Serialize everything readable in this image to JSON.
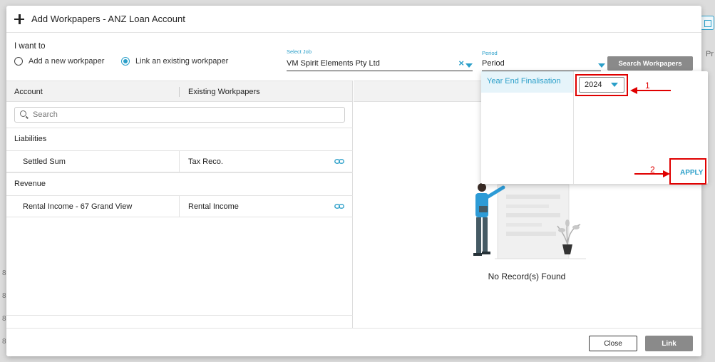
{
  "modal": {
    "title": "Add Workpapers - ANZ Loan Account"
  },
  "i_want_to": {
    "label": "I want to",
    "options": [
      {
        "label": "Add a new workpaper",
        "selected": false
      },
      {
        "label": "Link an existing workpaper",
        "selected": true
      }
    ]
  },
  "job": {
    "label": "Select Job",
    "value": "VM Spirit Elements Pty Ltd",
    "clear": "×"
  },
  "period": {
    "label": "Period",
    "value": "Period"
  },
  "search_workpapers_label": "Search Workpapers",
  "table": {
    "headers": [
      "Account",
      "Existing Workpapers"
    ],
    "search_placeholder": "Search",
    "groups": [
      {
        "name": "Liabilities",
        "rows": [
          {
            "account": "Settled Sum",
            "workpaper": "Tax Reco."
          }
        ]
      },
      {
        "name": "Revenue",
        "rows": [
          {
            "account": "Rental Income - 67 Grand View",
            "workpaper": "Rental Income"
          }
        ]
      }
    ]
  },
  "empty_state": "No Record(s) Found",
  "footer": {
    "close_label": "Close",
    "link_label": "Link"
  },
  "period_dropdown": {
    "option": "Year End Finalisation",
    "year": "2024",
    "apply_label": "APPLY"
  },
  "annotations": {
    "step1": "1",
    "step2": "2"
  },
  "background": {
    "column_header": "Pr",
    "side_numbers": [
      "8",
      "8",
      "8",
      "8"
    ]
  },
  "colors": {
    "accent": "#2b9fc9",
    "annotation": "#e00000",
    "disabled_button": "#8a8a8a"
  }
}
